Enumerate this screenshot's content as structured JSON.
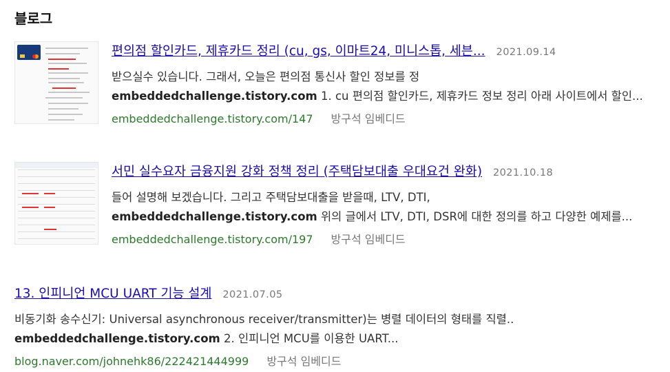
{
  "section": {
    "title": "블로그"
  },
  "results": [
    {
      "title": "편의점 할인카드, 제휴카드 정리 (cu, gs, 이마트24, 미니스톱, 세븐...",
      "date": "2021.09.14",
      "snippet_line1": "받으실수 있습니다. 그래서, 오늘은 편의점 통신사 할인 정보를 정",
      "site": "embeddedchallenge.tistory.com",
      "snippet_rest": " 1. cu 편의점 할인카드, 제휴카드 정보 정리 아래 사이트에서 할인...",
      "url_prefix": "embeddedchallenge.",
      "url_domain": "tistory.com",
      "url_path": "/147",
      "author": "방구석 임베디드",
      "thumbnail_icon": "card-document-thumbnail"
    },
    {
      "title": "서민 실수요자 금융지원 강화 정책 정리 (주택담보대출 우대요건 완화)",
      "date": "2021.10.18",
      "snippet_line1": "들어 설명해 보겠습니다. 그리고 주택담보대출을 받을때, LTV, DTI,",
      "site": "embeddedchallenge.tistory.com",
      "snippet_rest": " 위의 글에서 LTV, DTI, DSR에 대한 정의를 하고 다양한 예제를...",
      "url_prefix": "embeddedchallenge.",
      "url_domain": "tistory.com",
      "url_path": "/197",
      "author": "방구석 임베디드",
      "thumbnail_icon": "table-document-thumbnail"
    },
    {
      "title": "13. 인피니언 MCU UART 기능 설계",
      "date": "2021.07.05",
      "snippet_line1": "비동기화 송수신기: Universal asynchronous receiver/transmitter)는 병렬 데이터의 형태를 직렬..",
      "site": "embeddedchallenge.tistory.com",
      "snippet_rest": "  2. 인피니언 MCU를 이용한 UART...",
      "url_prefix": "blog.",
      "url_domain": "naver.com",
      "url_path": "/johnehk86/222421444999",
      "author": "방구석 임베디드"
    }
  ]
}
